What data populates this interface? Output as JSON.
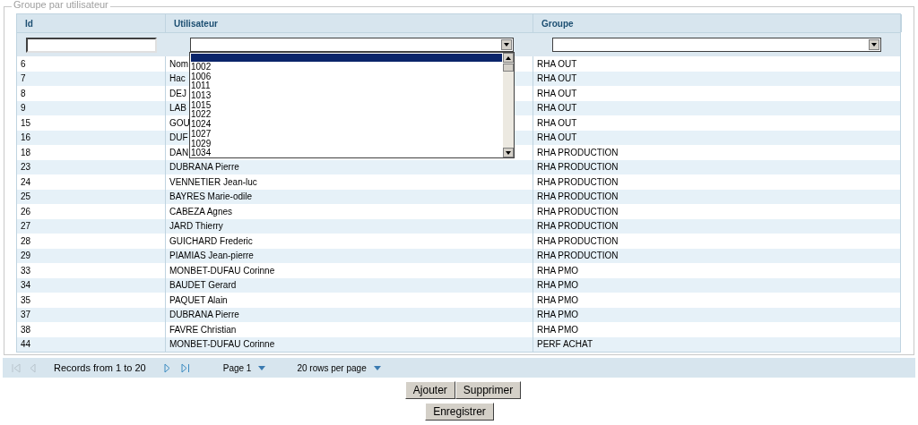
{
  "panel": {
    "legend": "Groupe par utilisateur"
  },
  "table": {
    "columns": [
      "Id",
      "Utilisateur",
      "Groupe"
    ],
    "user_filter": {
      "open": true,
      "blank_option_selected": true,
      "options": [
        {
          "label": "1002",
          "selected": false
        },
        {
          "label": "1006",
          "selected": false
        },
        {
          "label": "1011",
          "selected": false
        },
        {
          "label": "1013",
          "selected": false
        },
        {
          "label": "1015",
          "selected": false
        },
        {
          "label": "1022",
          "selected": false
        },
        {
          "label": "1024",
          "selected": false
        },
        {
          "label": "1027",
          "selected": false
        },
        {
          "label": "1029",
          "selected": false
        },
        {
          "label": "1034",
          "selected": false
        }
      ]
    },
    "rows": [
      {
        "id": "6",
        "user": "Nom",
        "group": "RHA OUT"
      },
      {
        "id": "7",
        "user": "Hac",
        "group": "RHA OUT"
      },
      {
        "id": "8",
        "user": "DEJ",
        "group": "RHA OUT"
      },
      {
        "id": "9",
        "user": "LAB",
        "group": "RHA OUT"
      },
      {
        "id": "15",
        "user": "GOU",
        "group": "RHA OUT"
      },
      {
        "id": "16",
        "user": "DUF",
        "group": "RHA OUT"
      },
      {
        "id": "18",
        "user": "DAN",
        "group": "RHA PRODUCTION"
      },
      {
        "id": "23",
        "user": "DUBRANA Pierre",
        "group": "RHA PRODUCTION"
      },
      {
        "id": "24",
        "user": "VENNETIER Jean-luc",
        "group": "RHA PRODUCTION"
      },
      {
        "id": "25",
        "user": "BAYRES Marie-odile",
        "group": "RHA PRODUCTION"
      },
      {
        "id": "26",
        "user": "CABEZA Agnes",
        "group": "RHA PRODUCTION"
      },
      {
        "id": "27",
        "user": "JARD Thierry",
        "group": "RHA PRODUCTION"
      },
      {
        "id": "28",
        "user": "GUICHARD Frederic",
        "group": "RHA PRODUCTION"
      },
      {
        "id": "29",
        "user": "PIAMIAS Jean-pierre",
        "group": "RHA PRODUCTION"
      },
      {
        "id": "33",
        "user": "MONBET-DUFAU Corinne",
        "group": "RHA PMO"
      },
      {
        "id": "34",
        "user": "BAUDET Gerard",
        "group": "RHA PMO"
      },
      {
        "id": "35",
        "user": "PAQUET Alain",
        "group": "RHA PMO"
      },
      {
        "id": "37",
        "user": "DUBRANA Pierre",
        "group": "RHA PMO"
      },
      {
        "id": "38",
        "user": "FAVRE Christian",
        "group": "RHA PMO"
      },
      {
        "id": "44",
        "user": "MONBET-DUFAU Corinne",
        "group": "PERF ACHAT"
      }
    ]
  },
  "pager": {
    "records": "Records from 1 to 20",
    "page": "Page 1",
    "rows_per_page": "20 rows per page"
  },
  "buttons": [
    "Ajouter",
    "Supprimer"
  ],
  "save_button": "Enregistrer"
}
